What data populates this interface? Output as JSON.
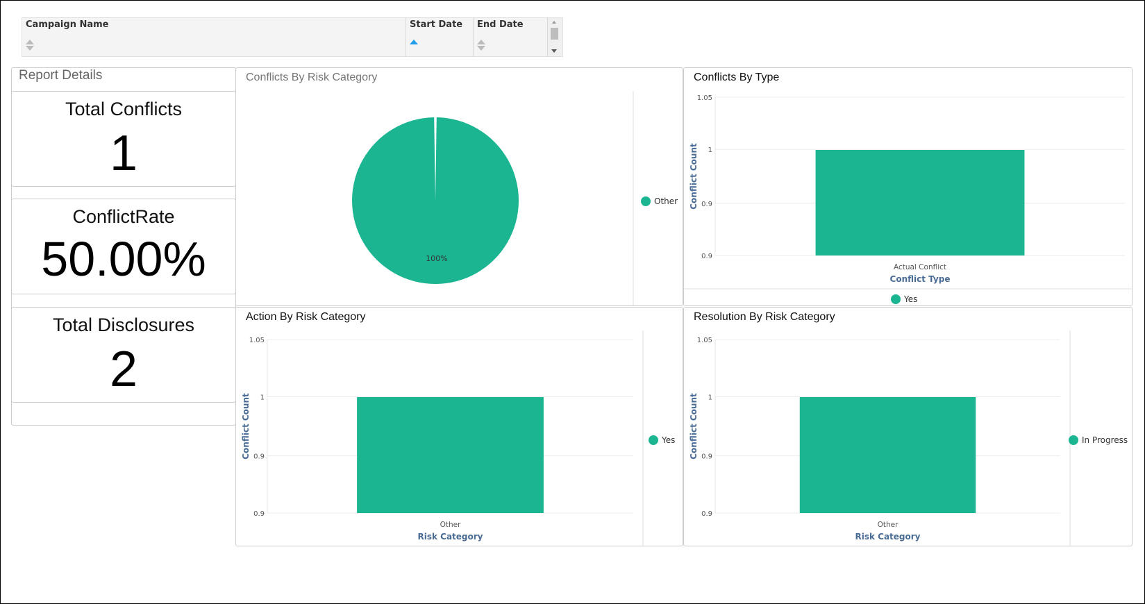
{
  "grid": {
    "columns": [
      {
        "label": "Campaign Name",
        "sort": "none"
      },
      {
        "label": "Start Date",
        "sort": "asc"
      },
      {
        "label": "End Date",
        "sort": "none"
      }
    ]
  },
  "report_details": {
    "title": "Report Details",
    "kpis": [
      {
        "label": "Total Conflicts",
        "value": "1"
      },
      {
        "label": "ConflictRate",
        "value": "50.00%"
      },
      {
        "label": "Total Disclosures",
        "value": "2"
      }
    ]
  },
  "colors": {
    "series": "#1bb592",
    "axis_title": "#4a6c94"
  },
  "chart_data": [
    {
      "type": "pie",
      "title": "Conflicts By Risk Category",
      "slices": [
        {
          "name": "Other",
          "value": 1,
          "label": "100%"
        }
      ],
      "legend": [
        "Other"
      ]
    },
    {
      "type": "bar",
      "title": "Conflicts By Type",
      "categories": [
        "Actual Conflict"
      ],
      "series": [
        {
          "name": "Yes",
          "values": [
            1
          ]
        }
      ],
      "xlabel": "Conflict Type",
      "ylabel": "Conflict Count",
      "ylim": [
        0.9,
        1.05
      ],
      "yticks": [
        "0.9",
        "0.9",
        "1",
        "1.05"
      ],
      "legend_placement": "bottom"
    },
    {
      "type": "bar",
      "title": "Action By Risk Category",
      "categories": [
        "Other"
      ],
      "series": [
        {
          "name": "Yes",
          "values": [
            1
          ]
        }
      ],
      "xlabel": "Risk Category",
      "ylabel": "Conflict Count",
      "ylim": [
        0.9,
        1.05
      ],
      "yticks": [
        "0.9",
        "0.9",
        "1",
        "1.05"
      ],
      "legend_placement": "right"
    },
    {
      "type": "bar",
      "title": "Resolution By Risk Category",
      "categories": [
        "Other"
      ],
      "series": [
        {
          "name": "In Progress",
          "values": [
            1
          ]
        }
      ],
      "xlabel": "Risk Category",
      "ylabel": "Conflict Count",
      "ylim": [
        0.9,
        1.05
      ],
      "yticks": [
        "0.9",
        "0.9",
        "1",
        "1.05"
      ],
      "legend_placement": "right"
    }
  ]
}
